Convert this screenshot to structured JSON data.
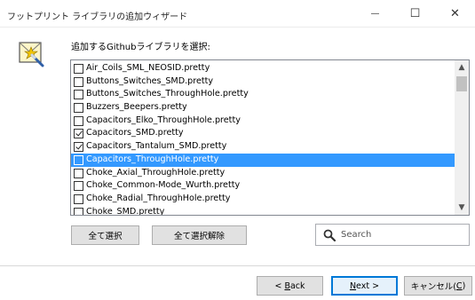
{
  "window": {
    "title": "フットプリント ライブラリの追加ウィザード",
    "controls": {
      "minimize": "—",
      "maximize": "☐",
      "close": "✕"
    }
  },
  "header": {
    "instruction": "追加するGithubライブラリを選択:"
  },
  "libraries": [
    {
      "name": "Air_Coils_SML_NEOSID.pretty",
      "checked": false,
      "selected": false
    },
    {
      "name": "Buttons_Switches_SMD.pretty",
      "checked": false,
      "selected": false
    },
    {
      "name": "Buttons_Switches_ThroughHole.pretty",
      "checked": false,
      "selected": false
    },
    {
      "name": "Buzzers_Beepers.pretty",
      "checked": false,
      "selected": false
    },
    {
      "name": "Capacitors_Elko_ThroughHole.pretty",
      "checked": false,
      "selected": false
    },
    {
      "name": "Capacitors_SMD.pretty",
      "checked": true,
      "selected": false
    },
    {
      "name": "Capacitors_Tantalum_SMD.pretty",
      "checked": true,
      "selected": false
    },
    {
      "name": "Capacitors_ThroughHole.pretty",
      "checked": false,
      "selected": true
    },
    {
      "name": "Choke_Axial_ThroughHole.pretty",
      "checked": false,
      "selected": false
    },
    {
      "name": "Choke_Common-Mode_Wurth.pretty",
      "checked": false,
      "selected": false
    },
    {
      "name": "Choke_Radial_ThroughHole.pretty",
      "checked": false,
      "selected": false
    },
    {
      "name": "Choke_SMD.pretty",
      "checked": false,
      "selected": false
    }
  ],
  "actions": {
    "select_all": "全て選択",
    "deselect_all": "全て選択解除"
  },
  "search": {
    "placeholder": "Search"
  },
  "footer": {
    "back_prefix": "< ",
    "back_key": "B",
    "back_rest": "ack",
    "next_key": "N",
    "next_rest": "ext >",
    "cancel_prefix": "キャンセル(",
    "cancel_key": "C",
    "cancel_suffix": ")"
  },
  "colors": {
    "selection": "#3399ff",
    "default_button_border": "#0078d7"
  }
}
